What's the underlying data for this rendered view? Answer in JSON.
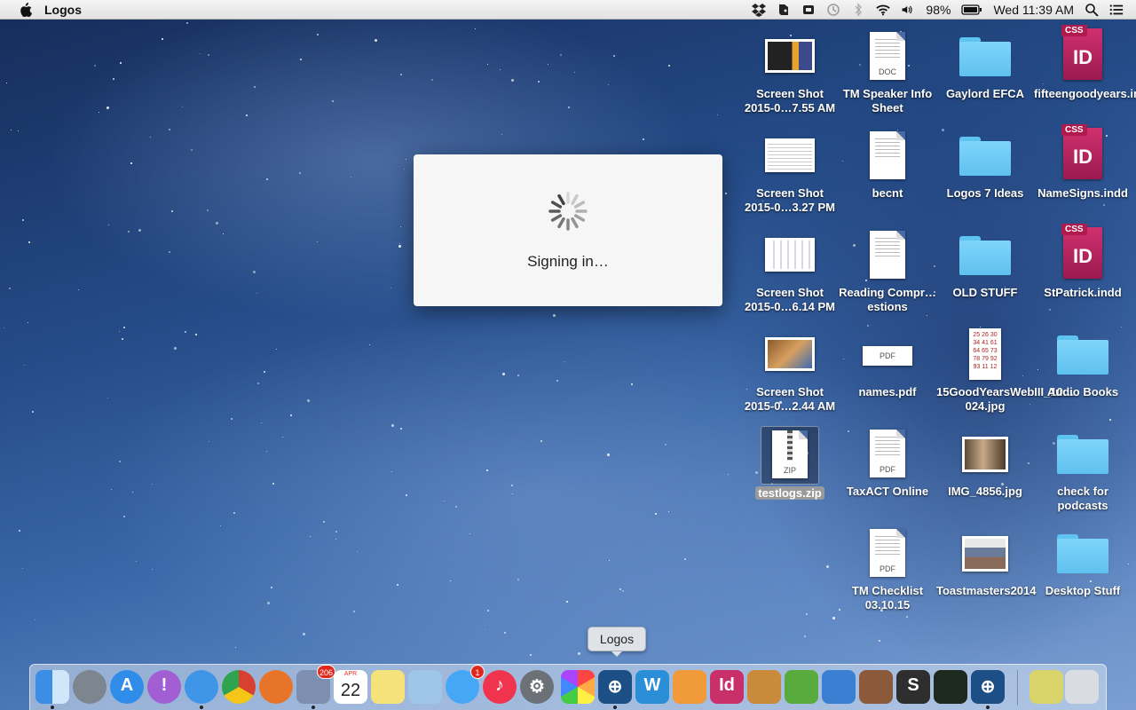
{
  "menubar": {
    "app_name": "Logos",
    "battery": "98%",
    "clock": "Wed 11:39 AM",
    "status_icons": [
      "dropbox-icon",
      "evernote-icon",
      "backup-icon",
      "time-machine-icon",
      "bluetooth-icon",
      "wifi-icon",
      "volume-icon",
      "battery-icon",
      "spotlight-icon",
      "notification-center-icon"
    ]
  },
  "dialog": {
    "message": "Signing in…"
  },
  "desktop": {
    "icons": [
      {
        "label": "Screen Shot 2015-0…7.55 AM",
        "kind": "screenshot"
      },
      {
        "label": "TM Speaker Info Sheet",
        "kind": "doc",
        "tag": "DOC"
      },
      {
        "label": "Gaylord EFCA",
        "kind": "folder"
      },
      {
        "label": "fifteengoodyears.indd",
        "kind": "indd",
        "tag": "CSS"
      },
      {
        "label": "Screen Shot 2015-0…3.27 PM",
        "kind": "screenshot"
      },
      {
        "label": "becnt",
        "kind": "doc",
        "tag": ""
      },
      {
        "label": "Logos 7 Ideas",
        "kind": "folder"
      },
      {
        "label": "NameSigns.indd",
        "kind": "indd",
        "tag": "CSS"
      },
      {
        "label": "Screen Shot 2015-0…6.14 PM",
        "kind": "screenshot"
      },
      {
        "label": "Reading Compr…estions",
        "kind": "doc",
        "tag": ""
      },
      {
        "label": "OLD STUFF",
        "kind": "folder"
      },
      {
        "label": "StPatrick.indd",
        "kind": "indd",
        "tag": "CSS"
      },
      {
        "label": "Screen Shot 2015-0…2.44 AM",
        "kind": "screenshot"
      },
      {
        "label": "names.pdf",
        "kind": "pdf-wide",
        "tag": "PDF"
      },
      {
        "label": "15GoodYearsWebIII_10…024.jpg",
        "kind": "calendar"
      },
      {
        "label": "Audio Books",
        "kind": "folder"
      },
      {
        "label": "testlogs.zip",
        "kind": "zip",
        "tag": "ZIP"
      },
      {
        "label": "TaxACT Online",
        "kind": "doc",
        "tag": "PDF"
      },
      {
        "label": "IMG_4856.jpg",
        "kind": "photo"
      },
      {
        "label": "check for podcasts",
        "kind": "folder"
      },
      {
        "label": "TM Checklist 03.10.15",
        "kind": "doc",
        "tag": "PDF"
      },
      {
        "label": "Toastmasters2014",
        "kind": "photo"
      },
      {
        "label": "Desktop Stuff",
        "kind": "folder"
      }
    ]
  },
  "tooltip": "Logos",
  "dock": {
    "items": [
      {
        "name": "finder",
        "glyph": "",
        "color": "#3c8de6"
      },
      {
        "name": "launchpad",
        "glyph": "",
        "color": "#7d858f"
      },
      {
        "name": "app-store",
        "glyph": "A",
        "color": "#2f8de9"
      },
      {
        "name": "feedback",
        "glyph": "!",
        "color": "#a25fd3"
      },
      {
        "name": "safari",
        "glyph": "",
        "color": "#3f96e8"
      },
      {
        "name": "chrome",
        "glyph": "",
        "color": "#d8402f"
      },
      {
        "name": "firefox",
        "glyph": "",
        "color": "#e8742a"
      },
      {
        "name": "mail",
        "glyph": "",
        "color": "#7d8fb0",
        "badge": "206"
      },
      {
        "name": "calendar",
        "glyph": "22",
        "color": "#ffffff",
        "small": "APR"
      },
      {
        "name": "notes",
        "glyph": "",
        "color": "#f5e27a"
      },
      {
        "name": "preview",
        "glyph": "",
        "color": "#9fc5e8"
      },
      {
        "name": "messages",
        "glyph": "",
        "color": "#45a7f5",
        "badge": "1"
      },
      {
        "name": "itunes",
        "glyph": "♪",
        "color": "#f0344e"
      },
      {
        "name": "system-preferences",
        "glyph": "⚙",
        "color": "#6c7077"
      },
      {
        "name": "photos",
        "glyph": "",
        "color": "#ffffff"
      },
      {
        "name": "logos-active",
        "glyph": "⊕",
        "color": "#1c4f86"
      },
      {
        "name": "word",
        "glyph": "W",
        "color": "#2a8fd6"
      },
      {
        "name": "pages",
        "glyph": "",
        "color": "#f09a3a"
      },
      {
        "name": "indesign",
        "glyph": "Id",
        "color": "#c92f6b"
      },
      {
        "name": "cup",
        "glyph": "",
        "color": "#c98a3a"
      },
      {
        "name": "evernote",
        "glyph": "",
        "color": "#58ac3e"
      },
      {
        "name": "keynote",
        "glyph": "",
        "color": "#3b7fd2"
      },
      {
        "name": "books",
        "glyph": "",
        "color": "#8a5a3a"
      },
      {
        "name": "scrivener",
        "glyph": "S",
        "color": "#2e2e2e"
      },
      {
        "name": "activity-monitor",
        "glyph": "",
        "color": "#1e2a1e"
      },
      {
        "name": "logos",
        "glyph": "⊕",
        "color": "#1c4f86"
      },
      {
        "name": "document-stack",
        "glyph": "",
        "color": "#d9d36a"
      },
      {
        "name": "trash",
        "glyph": "",
        "color": "#d9dde2"
      }
    ]
  }
}
